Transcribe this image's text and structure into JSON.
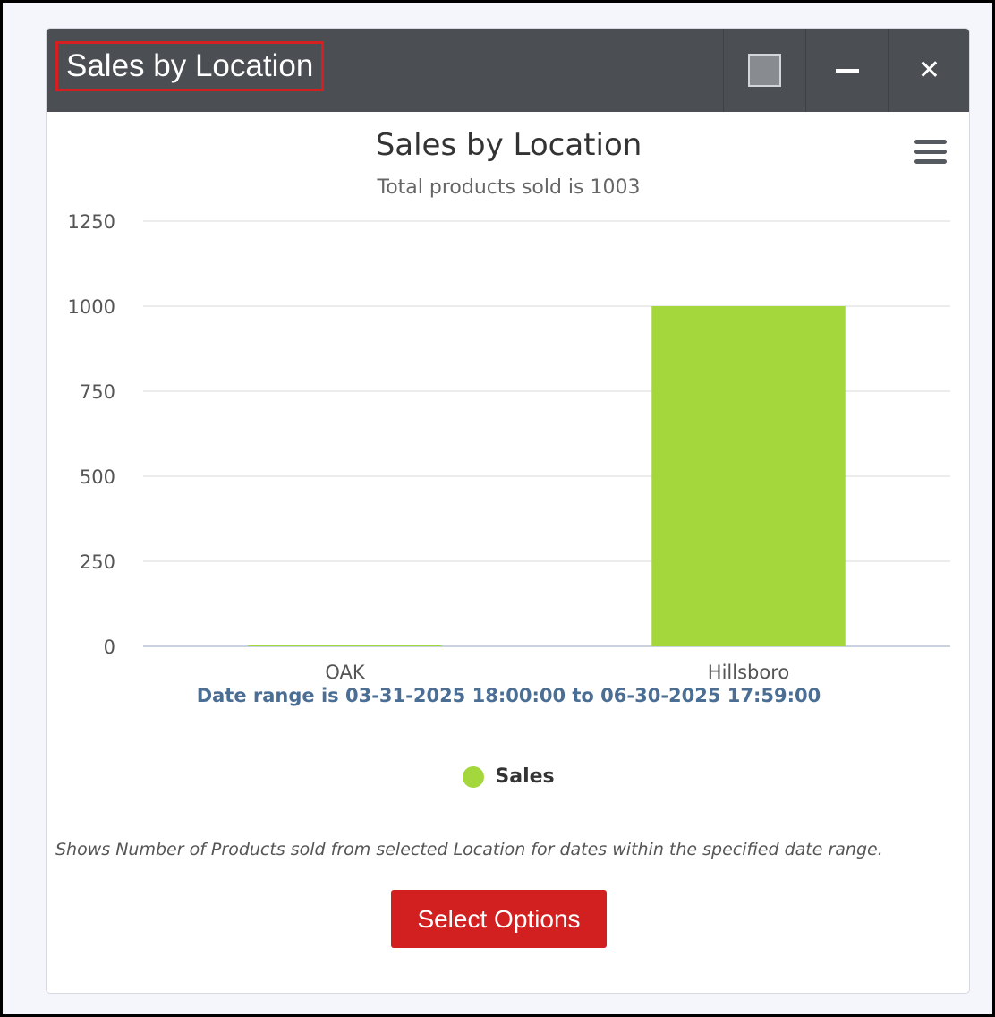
{
  "window": {
    "title": "Sales by Location",
    "controls": {
      "maximize_icon": "square-icon",
      "minimize_icon": "minimize-icon",
      "close_glyph": "✕"
    }
  },
  "chart_data": {
    "type": "bar",
    "title": "Sales by Location",
    "subtitle": "Total products sold is 1003",
    "categories": [
      "OAK",
      "Hillsboro"
    ],
    "series": [
      {
        "name": "Sales",
        "values": [
          3,
          1000
        ],
        "color": "#a4d73b"
      }
    ],
    "ylim": [
      0,
      1250
    ],
    "yticks": [
      0,
      250,
      500,
      750,
      1000,
      1250
    ],
    "grid": true,
    "legend_position": "bottom-center"
  },
  "chart_caption": "Date range is 03-31-2025 18:00:00 to 06-30-2025 17:59:00",
  "description": "Shows Number of Products sold from selected Location for dates within the specified date range.",
  "actions": {
    "select_options": "Select Options"
  },
  "colors": {
    "titlebar": "#4b4f54",
    "accent_red": "#d21f1f",
    "caption_blue": "#4a6e94",
    "bar_green": "#a4d73b"
  }
}
